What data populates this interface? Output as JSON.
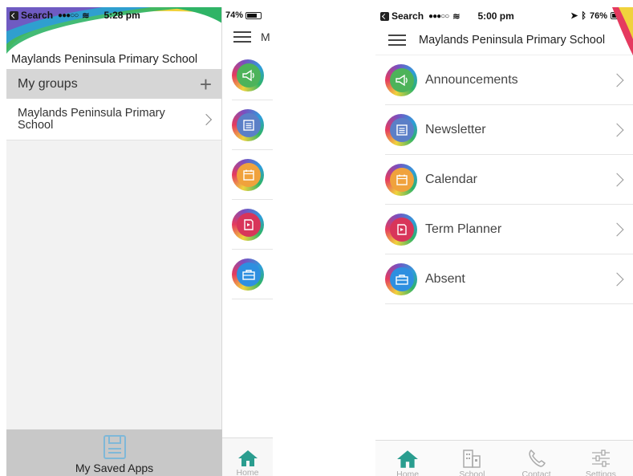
{
  "left_screen": {
    "status": {
      "back_app": "Search",
      "signal": "●●●○○",
      "time": "5:28 pm"
    },
    "status_behind": {
      "battery": "74%",
      "battery_level": 0.74
    },
    "drawer": {
      "title": "Maylands Peninsula Primary School",
      "groups_header": "My groups",
      "add_icon": "plus-icon",
      "groups": [
        {
          "label": "Maylands Peninsula Primary School"
        }
      ],
      "saved_apps_label": "My Saved Apps"
    },
    "behind": {
      "nav_title": "M",
      "icons": [
        "megaphone-icon",
        "newsletter-icon",
        "calendar-icon",
        "planner-icon",
        "briefcase-icon"
      ],
      "tab_home": "Home"
    }
  },
  "right_screen": {
    "status": {
      "back_app": "Search",
      "signal": "●●●○○",
      "time": "5:00 pm",
      "battery": "76%",
      "battery_level": 0.76
    },
    "header_title": "Maylands Peninsula Primary School",
    "items": [
      {
        "label": "Announcements",
        "icon": "megaphone-icon",
        "color": "#4db35a"
      },
      {
        "label": "Newsletter",
        "icon": "newsletter-icon",
        "color": "#5b7fc7"
      },
      {
        "label": "Calendar",
        "icon": "calendar-icon",
        "color": "#f0a23c"
      },
      {
        "label": "Term Planner",
        "icon": "planner-icon",
        "color": "#d8355a"
      },
      {
        "label": "Absent",
        "icon": "briefcase-icon",
        "color": "#2e8fe0"
      }
    ],
    "tabs": [
      {
        "label": "Home",
        "icon": "home-icon"
      },
      {
        "label": "School",
        "icon": "school-icon"
      },
      {
        "label": "Contact",
        "icon": "phone-icon"
      },
      {
        "label": "Settings",
        "icon": "settings-icon"
      }
    ]
  },
  "colors": {
    "home_tab": "#2a9d8f",
    "announcements": "#4db35a",
    "newsletter": "#5b7fc7",
    "calendar": "#f0a23c",
    "term_planner": "#d8355a",
    "absent": "#2e8fe0"
  }
}
